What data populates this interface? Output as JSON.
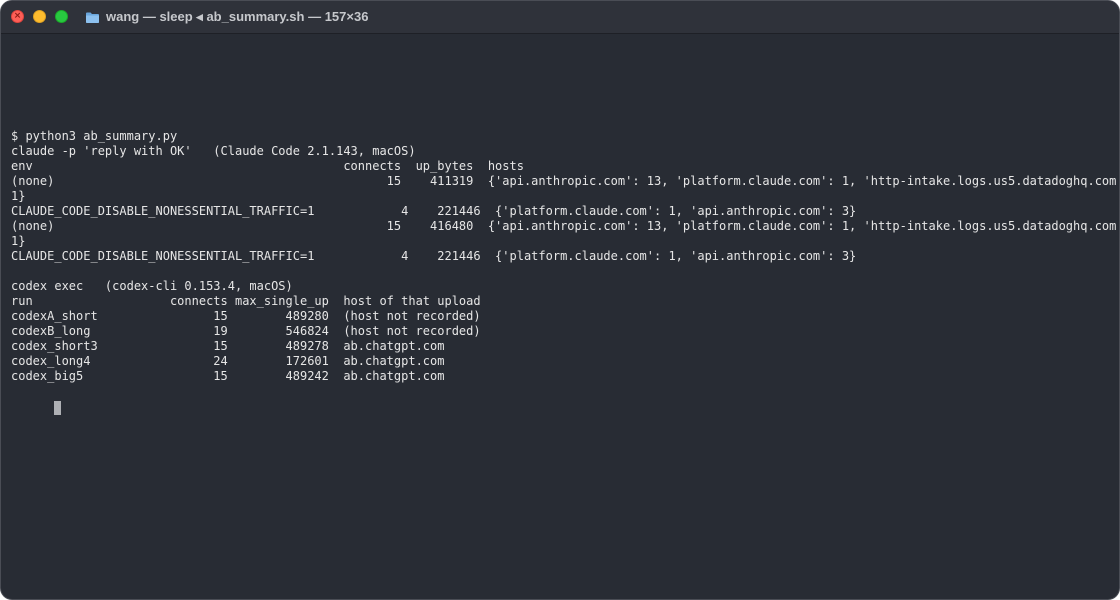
{
  "window": {
    "title": "wang — sleep ◂ ab_summary.sh — 157×36"
  },
  "terminal": {
    "lines": [
      "$ python3 ab_summary.py",
      "claude -p 'reply with OK'   (Claude Code 2.1.143, macOS)",
      "env                                           connects  up_bytes  hosts",
      "(none)                                              15    411319  {'api.anthropic.com': 13, 'platform.claude.com': 1, 'http-intake.logs.us5.datadoghq.com':",
      "1}",
      "CLAUDE_CODE_DISABLE_NONESSENTIAL_TRAFFIC=1            4    221446  {'platform.claude.com': 1, 'api.anthropic.com': 3}",
      "(none)                                              15    416480  {'api.anthropic.com': 13, 'platform.claude.com': 1, 'http-intake.logs.us5.datadoghq.com':",
      "1}",
      "CLAUDE_CODE_DISABLE_NONESSENTIAL_TRAFFIC=1            4    221446  {'platform.claude.com': 1, 'api.anthropic.com': 3}",
      "",
      "codex exec   (codex-cli 0.153.4, macOS)",
      "run                   connects max_single_up  host of that upload",
      "codexA_short                15        489280  (host not recorded)",
      "codexB_long                 19        546824  (host not recorded)",
      "codex_short3                15        489278  ab.chatgpt.com",
      "codex_long4                 24        172601  ab.chatgpt.com",
      "codex_big5                  15        489242  ab.chatgpt.com"
    ]
  },
  "colors": {
    "background": "#282c34",
    "text": "#e6e6e6",
    "close": "#fe5f57",
    "minimize": "#febc2e",
    "maximize": "#28c840"
  },
  "icons": {
    "close": "close-icon",
    "folder": "folder-icon"
  }
}
